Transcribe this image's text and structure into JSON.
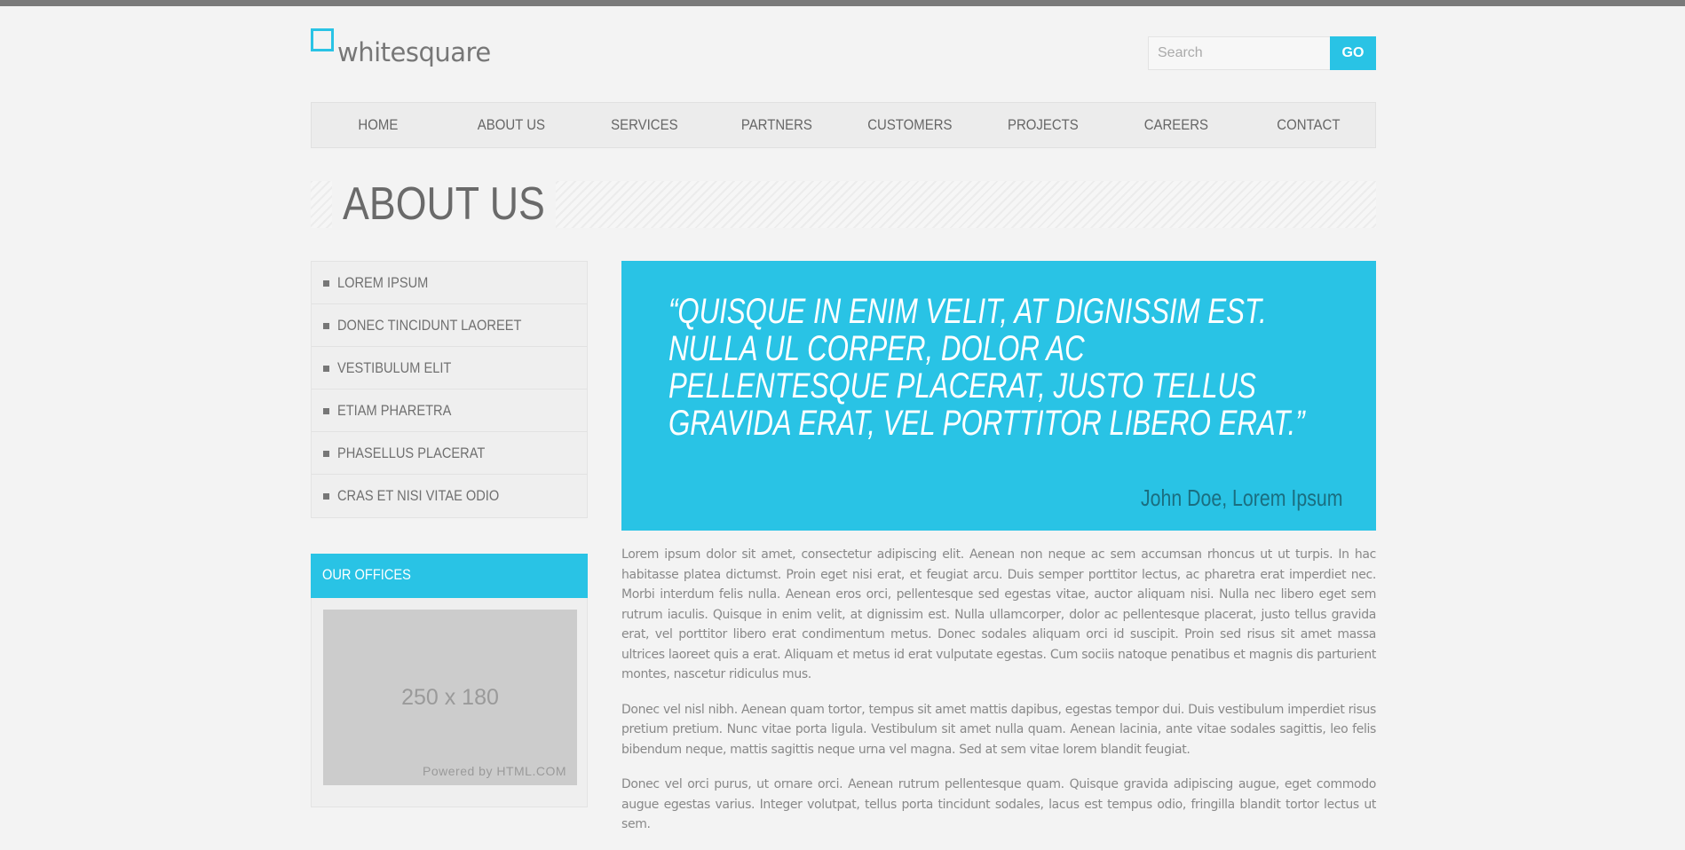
{
  "brand": {
    "name": "whitesquare"
  },
  "search": {
    "placeholder": "Search",
    "button_label": "GO"
  },
  "nav": {
    "items": [
      "HOME",
      "ABOUT US",
      "SERVICES",
      "PARTNERS",
      "CUSTOMERS",
      "PROJECTS",
      "CAREERS",
      "CONTACT"
    ]
  },
  "page": {
    "title": "ABOUT US"
  },
  "sidebar": {
    "items": [
      "LOREM IPSUM",
      "DONEC TINCIDUNT LAOREET",
      "VESTIBULUM ELIT",
      "ETIAM PHARETRA",
      "PHASELLUS PLACERAT",
      "CRAS ET NISI VITAE ODIO"
    ]
  },
  "offices": {
    "title": "OUR OFFICES",
    "image_size": "250 x 180",
    "powered_by": "Powered by HTML.COM"
  },
  "quote": {
    "text": "“QUISQUE IN ENIM VELIT, AT DIGNISSIM EST. NULLA UL CORPER, DOLOR AC PELLENTESQUE PLACERAT, JUSTO TELLUS GRAVIDA ERAT, VEL PORTTITOR LIBERO ERAT.”",
    "author": "John Doe, Lorem Ipsum"
  },
  "content": {
    "paragraphs": [
      "Lorem ipsum dolor sit amet, consectetur adipiscing elit. Aenean non neque ac sem accumsan rhoncus ut ut turpis. In hac habitasse platea dictumst. Proin eget nisi erat, et feugiat arcu. Duis semper porttitor lectus, ac pharetra erat imperdiet nec. Morbi interdum felis nulla. Aenean eros orci, pellentesque sed egestas vitae, auctor aliquam nisi. Nulla nec libero eget sem rutrum iaculis. Quisque in enim velit, at dignissim est. Nulla ullamcorper, dolor ac pellentesque placerat, justo tellus gravida erat, vel porttitor libero erat condimentum metus. Donec sodales aliquam orci id suscipit. Proin sed risus sit amet massa ultrices laoreet quis a erat. Aliquam et metus id erat vulputate egestas. Cum sociis natoque penatibus et magnis dis parturient montes, nascetur ridiculus mus.",
      "Donec vel nisl nibh. Aenean quam tortor, tempus sit amet mattis dapibus, egestas tempor dui. Duis vestibulum imperdiet risus pretium pretium. Nunc vitae porta ligula. Vestibulum sit amet nulla quam. Aenean lacinia, ante vitae sodales sagittis, leo felis bibendum neque, mattis sagittis neque urna vel magna. Sed at sem vitae lorem blandit feugiat.",
      "Donec vel orci purus, ut ornare orci. Aenean rutrum pellentesque quam. Quisque gravida adipiscing augue, eget commodo augue egestas varius. Integer volutpat, tellus porta tincidunt sodales, lacus est tempus odio, fringilla blandit tortor lectus ut sem."
    ]
  },
  "colors": {
    "accent": "#29c3e5",
    "text": "#777777",
    "background": "#f3f3f3"
  }
}
